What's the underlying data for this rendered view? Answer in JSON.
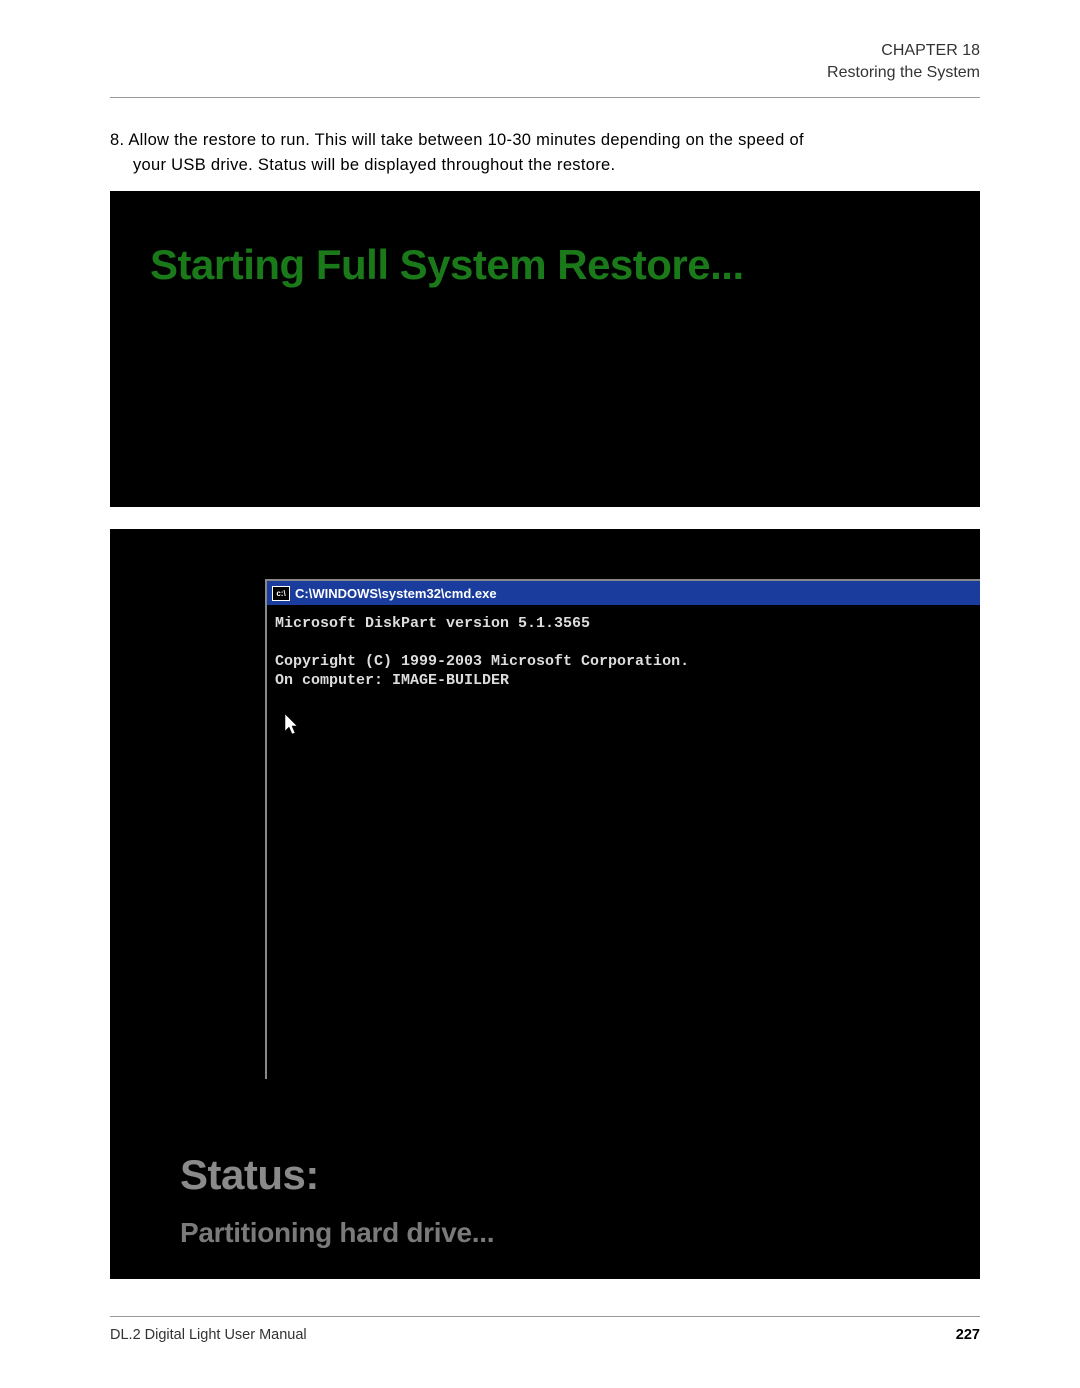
{
  "header": {
    "chapter": "CHAPTER 18",
    "section": "Restoring the System"
  },
  "step": {
    "number": "8. ",
    "text_line1": "Allow the restore to run. This will take between 10-30 minutes depending on the speed of",
    "text_line2": "your USB drive. Status will be displayed throughout the restore."
  },
  "screenshot1": {
    "title": "Starting Full System Restore..."
  },
  "screenshot2": {
    "cmd_icon": "c:\\",
    "cmd_title": "C:\\WINDOWS\\system32\\cmd.exe",
    "cmd_line1": "Microsoft DiskPart version 5.1.3565",
    "cmd_line2": "Copyright (C) 1999-2003 Microsoft Corporation.",
    "cmd_line3": "On computer: IMAGE-BUILDER",
    "status_label": "Status:",
    "status_text": "Partitioning hard drive..."
  },
  "footer": {
    "manual": "DL.2 Digital Light User Manual",
    "page": "227"
  }
}
